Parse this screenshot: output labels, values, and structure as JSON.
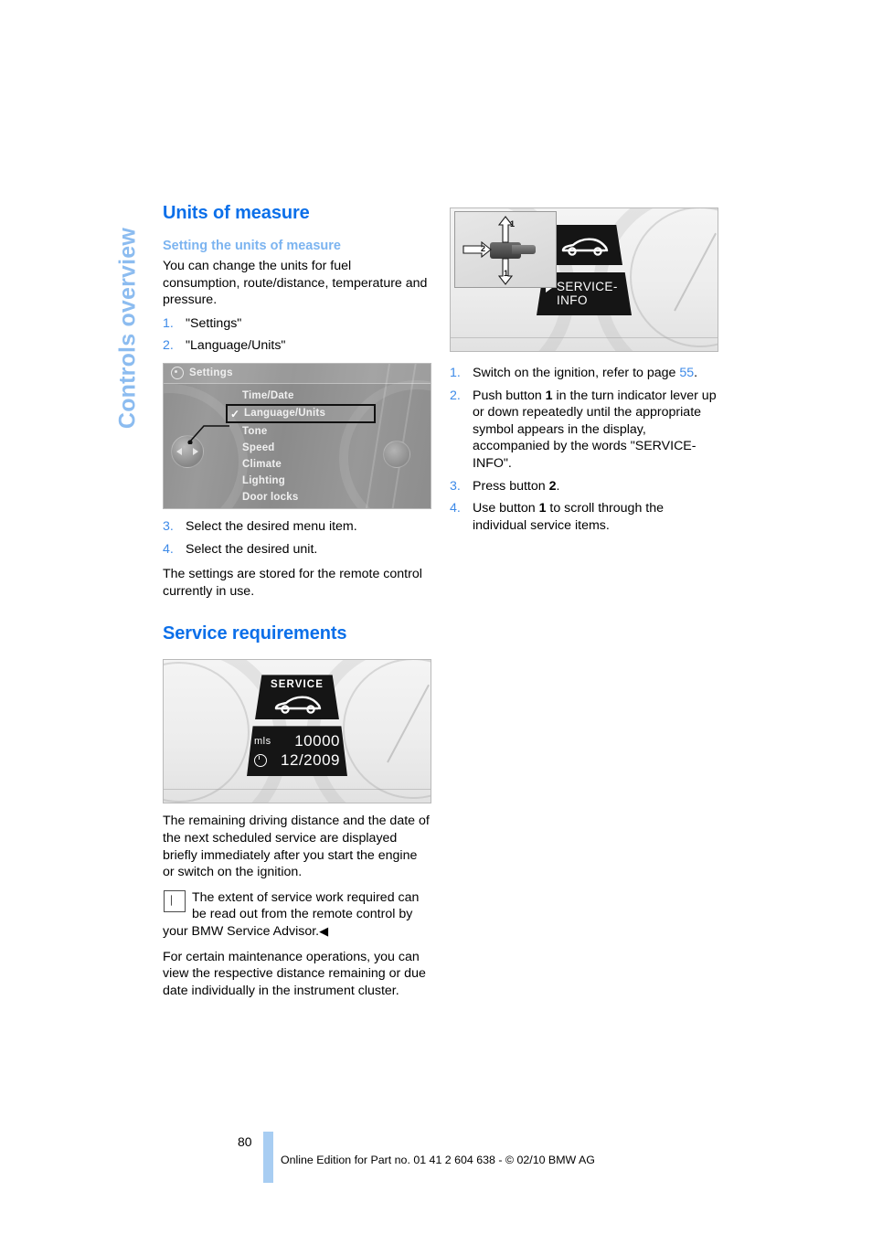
{
  "chapter_tab": {
    "label": "Controls overview"
  },
  "left_column": {
    "section1": {
      "title": "Units of measure",
      "subtitle": "Setting the units of measure",
      "intro": "You can change the units for fuel consumption, route/distance, temperature and pressure.",
      "steps_before_figure": [
        {
          "num": "1.",
          "text": "\"Settings\""
        },
        {
          "num": "2.",
          "text": "\"Language/Units\""
        }
      ],
      "figure": {
        "name": "idrive-settings-menu",
        "header_label": "Settings",
        "items": [
          {
            "label": "Time/Date",
            "selected": false
          },
          {
            "label": "Language/Units",
            "selected": true
          },
          {
            "label": "Tone",
            "selected": false
          },
          {
            "label": "Speed",
            "selected": false
          },
          {
            "label": "Climate",
            "selected": false
          },
          {
            "label": "Lighting",
            "selected": false
          },
          {
            "label": "Door locks",
            "selected": false
          }
        ],
        "check_glyph": "✓"
      },
      "steps_after_figure": [
        {
          "num": "3.",
          "text": "Select the desired menu item."
        },
        {
          "num": "4.",
          "text": "Select the desired unit."
        }
      ],
      "closing": "The settings are stored for the remote control currently in use."
    },
    "section2": {
      "title": "Service requirements",
      "figure": {
        "name": "instrument-cluster-service-display",
        "service_label": "SERVICE",
        "distance_unit": "mls",
        "distance_value": "10000",
        "date_value": "12/2009"
      },
      "paragraph1": "The remaining driving distance and the date of the next scheduled service are displayed briefly immediately after you start the engine or switch on the ignition.",
      "note": {
        "text": "The extent of service work required can be read out from the remote control by your BMW Service Advisor.",
        "end_marker": "◀"
      },
      "paragraph2": "For certain maintenance operations, you can view the respective distance remaining or due date individually in the instrument cluster."
    }
  },
  "right_column": {
    "figure": {
      "name": "instrument-cluster-service-info",
      "info_label": "SERVICE-",
      "info_label2": "INFO",
      "lever_button_1": "1",
      "lever_button_1b": "1",
      "lever_button_2": "2"
    },
    "steps": [
      {
        "num": "1.",
        "parts": [
          {
            "type": "text",
            "value": "Switch on the ignition, refer to page "
          },
          {
            "type": "xref",
            "value": "55"
          },
          {
            "type": "text",
            "value": "."
          }
        ]
      },
      {
        "num": "2.",
        "parts": [
          {
            "type": "text",
            "value": "Push button "
          },
          {
            "type": "bold",
            "value": "1"
          },
          {
            "type": "text",
            "value": " in the turn indicator lever up or down repeatedly until the appropriate symbol appears in the display, accompanied by the words \"SERVICE-INFO\"."
          }
        ]
      },
      {
        "num": "3.",
        "parts": [
          {
            "type": "text",
            "value": "Press button "
          },
          {
            "type": "bold",
            "value": "2"
          },
          {
            "type": "text",
            "value": "."
          }
        ]
      },
      {
        "num": "4.",
        "parts": [
          {
            "type": "text",
            "value": "Use button "
          },
          {
            "type": "bold",
            "value": "1"
          },
          {
            "type": "text",
            "value": " to scroll through the individual service items."
          }
        ]
      }
    ]
  },
  "footer": {
    "page_number": "80",
    "text": "Online Edition for Part no. 01 41 2 604 638 - © 02/10 BMW AG"
  },
  "colors": {
    "heading_blue": "#0b6fe9",
    "subheading_blue": "#7cb4f0",
    "tab_blue": "#8cbcf0",
    "xref_blue": "#3d8ae8",
    "page_bar_blue": "#a8cdf2"
  }
}
